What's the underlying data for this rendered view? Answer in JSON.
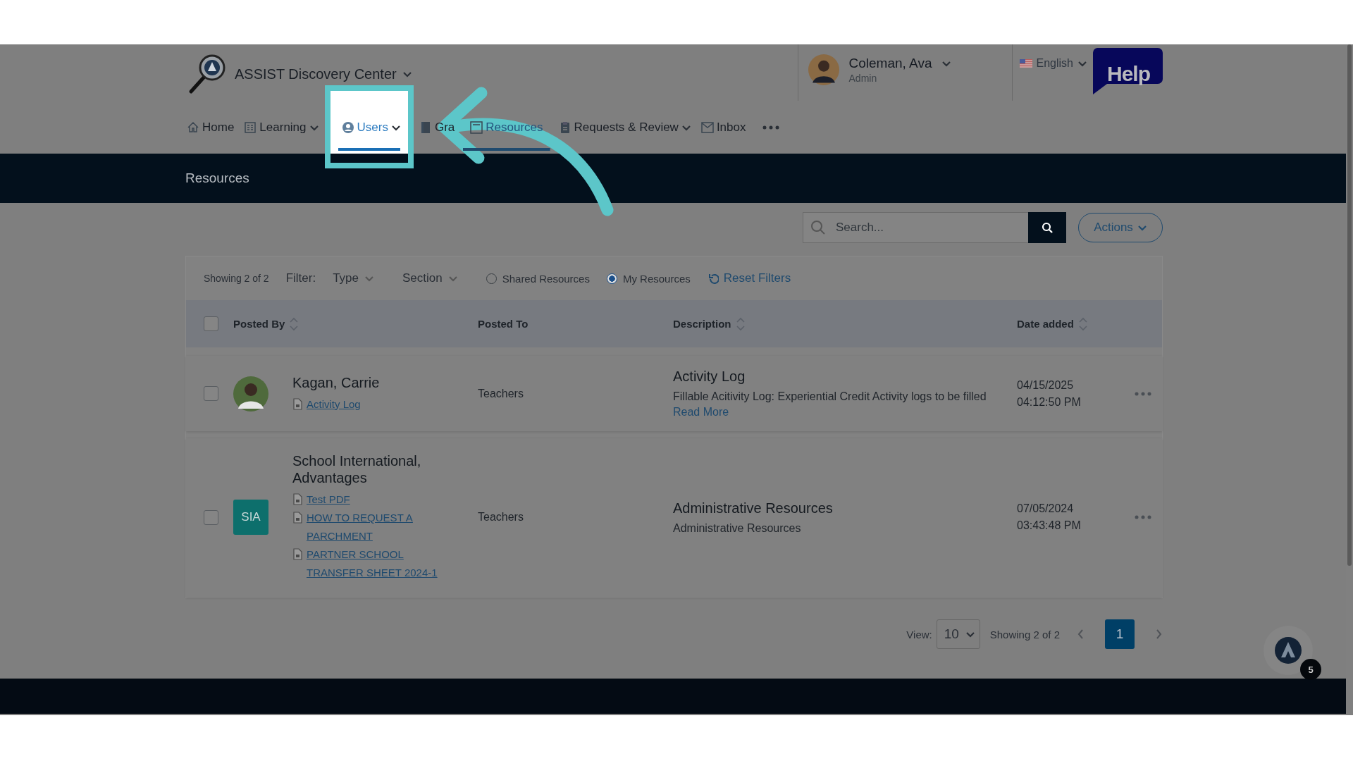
{
  "header": {
    "app_title": "ASSIST Discovery Center",
    "user": {
      "name": "Coleman, Ava",
      "role": "Admin"
    },
    "language": "English",
    "help": "Help"
  },
  "nav": [
    {
      "label": "Home",
      "dropdown": false,
      "selected": false,
      "highlighted": false
    },
    {
      "label": "Learning",
      "dropdown": true,
      "selected": false,
      "highlighted": false
    },
    {
      "label": "Users",
      "dropdown": true,
      "selected": false,
      "highlighted": true
    },
    {
      "label": "Gra",
      "dropdown": false,
      "selected": false,
      "highlighted": false
    },
    {
      "label": "Resources",
      "dropdown": false,
      "selected": true,
      "highlighted": false
    },
    {
      "label": "Requests & Review",
      "dropdown": true,
      "selected": false,
      "highlighted": false
    },
    {
      "label": "Inbox",
      "dropdown": false,
      "selected": false,
      "highlighted": false
    }
  ],
  "page_title": "Resources",
  "search": {
    "placeholder": "Search..."
  },
  "actions": "Actions",
  "filters": {
    "count": "Showing 2 of 2",
    "label": "Filter:",
    "dropdowns": [
      "Type",
      "Section"
    ],
    "radios": [
      {
        "label": "Shared Resources",
        "selected": false
      },
      {
        "label": "My Resources",
        "selected": true
      }
    ],
    "reset": "Reset Filters"
  },
  "table": {
    "select_all": {
      "checked": false
    },
    "columns": [
      {
        "label": "Posted By",
        "sortable": true
      },
      {
        "label": "Posted To",
        "sortable": false
      },
      {
        "label": "Description",
        "sortable": true
      },
      {
        "label": "Date added",
        "sortable": true
      }
    ],
    "rows": [
      {
        "checked": false,
        "avatar": {
          "kind": "photo"
        },
        "posted_by": "Kagan, Carrie",
        "attachments": [
          "Activity Log"
        ],
        "posted_to": "Teachers",
        "title": "Activity Log",
        "description": "Fillable Acitivity Log: Experiential Credit Activity logs to be filled",
        "read_more": "Read More",
        "date": "04/15/2025",
        "time": "04:12:50 PM"
      },
      {
        "checked": false,
        "avatar": {
          "kind": "initials",
          "text": "SIA"
        },
        "posted_by": "School International, Advantages",
        "attachments": [
          "Test PDF",
          "HOW TO REQUEST A PARCHMENT",
          "PARTNER SCHOOL TRANSFER SHEET 2024-1"
        ],
        "posted_to": "Teachers",
        "title": "Administrative Resources",
        "description": "Administrative Resources",
        "date": "07/05/2024",
        "time": "03:43:48 PM"
      }
    ]
  },
  "pagination": {
    "view_label": "View:",
    "page_size": "10",
    "count": "Showing 2 of 2",
    "pages": [
      {
        "label": "1",
        "selected": true
      }
    ]
  },
  "chat": {
    "badge": "5"
  }
}
